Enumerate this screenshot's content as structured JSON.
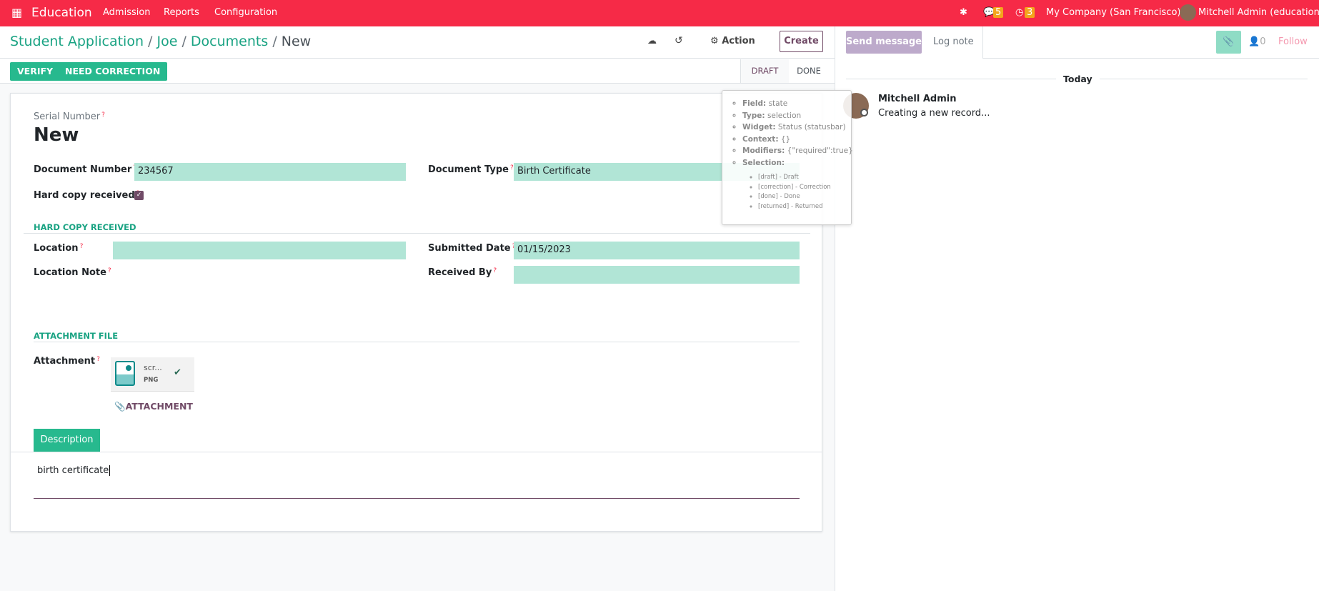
{
  "navbar": {
    "app": "Education",
    "menus": [
      "Admission",
      "Reports",
      "Configuration"
    ],
    "chat_count": "5",
    "activity_count": "3",
    "company": "My Company (San Francisco)",
    "user": "Mitchell Admin (education)",
    "bg_color": "#f62a47"
  },
  "breadcrumb": {
    "items": [
      "Student Application",
      "Joe",
      "Documents"
    ],
    "current": "New"
  },
  "toolbar": {
    "action": "Action",
    "create": "Create"
  },
  "statusbar": {
    "verify": "VERIFY",
    "need_correction": "NEED CORRECTION",
    "stages": [
      "DRAFT",
      "DONE"
    ],
    "active": "DRAFT"
  },
  "form": {
    "serial_label": "Serial Number",
    "serial_value": "New",
    "document_number_label": "Document Number",
    "document_number": "234567",
    "document_type_label": "Document Type",
    "document_type": "Birth Certificate",
    "hard_copy_label": "Hard copy received",
    "hard_copy_checked": true,
    "section_hard_copy": "HARD COPY RECEIVED",
    "location_label": "Location",
    "location": "",
    "submitted_date_label": "Submitted Date",
    "submitted_date": "01/15/2023",
    "location_note_label": "Location Note",
    "received_by_label": "Received By",
    "received_by": "",
    "section_attachment": "ATTACHMENT FILE",
    "attachment_label": "Attachment",
    "file_name": "scr...",
    "file_type": "PNG",
    "attach_button": "ATTACHMENT",
    "tab_description": "Description",
    "description": "birth certificate"
  },
  "tooltip": {
    "items": [
      {
        "k": "Field:",
        "v": "state"
      },
      {
        "k": "Type:",
        "v": "selection"
      },
      {
        "k": "Widget:",
        "v": "Status (statusbar)"
      },
      {
        "k": "Context:",
        "v": "{}"
      },
      {
        "k": "Modifiers:",
        "v": "{\"required\":true}"
      },
      {
        "k": "Selection:",
        "v": ""
      }
    ],
    "selection": [
      "[draft] - Draft",
      "[correction] - Correction",
      "[done] - Done",
      "[returned] - Returned"
    ]
  },
  "chatter": {
    "send_message": "Send message",
    "log_note": "Log note",
    "followers": "0",
    "follow": "Follow",
    "today": "Today",
    "author": "Mitchell Admin",
    "message": "Creating a new record..."
  }
}
